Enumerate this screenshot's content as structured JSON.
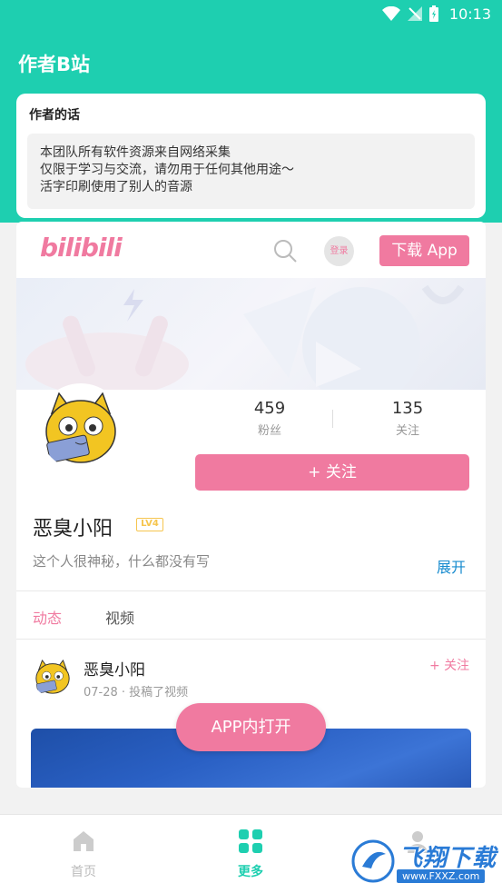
{
  "status_bar": {
    "time": "10:13"
  },
  "header": {
    "title": "作者B站"
  },
  "notice": {
    "title": "作者的话",
    "lines": [
      "本团队所有软件资源来自网络采集",
      "仅限于学习与交流，请勿用于任何其他用途～",
      "活字印刷使用了别人的音源"
    ]
  },
  "web": {
    "logo": "bilibili",
    "login_label": "登录",
    "download_label": "下载 App",
    "stats": [
      {
        "value": "459",
        "label": "粉丝"
      },
      {
        "value": "135",
        "label": "关注"
      }
    ],
    "follow_label": "+ 关注",
    "username": "恶臭小阳",
    "level": "LV4",
    "bio": "这个人很神秘，什么都没有写",
    "expand_label": "展开",
    "tabs": [
      "动态",
      "视频"
    ],
    "feed": {
      "user": "恶臭小阳",
      "meta": "07-28 · 投稿了视频",
      "follow_label": "+ 关注"
    }
  },
  "floating_button": "APP内打开",
  "bottom_nav": [
    "首页",
    "更多",
    ""
  ],
  "watermark": {
    "text": "飞翔下载",
    "url": "www.FXXZ.com"
  },
  "colors": {
    "teal": "#1ecfb0",
    "pink": "#f07aa0",
    "link_blue": "#178bcf"
  }
}
